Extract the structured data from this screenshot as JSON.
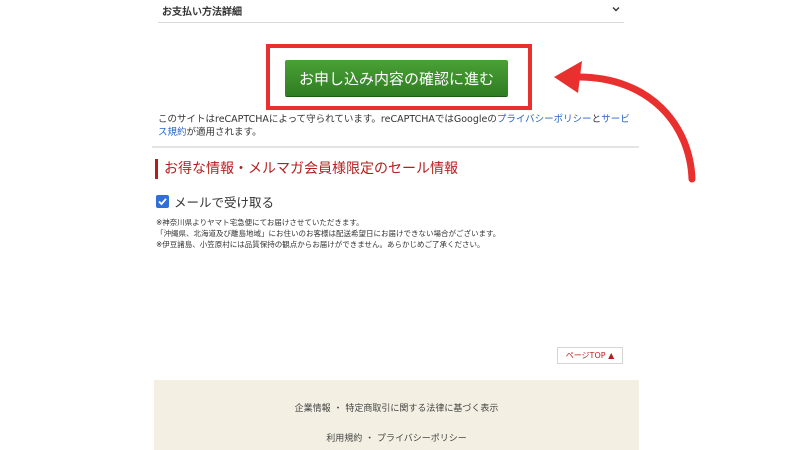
{
  "payment": {
    "label": "お支払い方法詳細"
  },
  "confirm": {
    "button_label": "お申し込み内容の確認に進む"
  },
  "recaptcha": {
    "prefix": "このサイトはreCAPTCHAによって守られています。reCAPTCHAではGoogleの",
    "privacy_link": "プライバシーポリシー",
    "conjunction": "と",
    "terms_link": "サービス規約",
    "suffix": "が適用されます。"
  },
  "newsletter": {
    "title": "お得な情報・メルマガ会員様限定のセール情報",
    "checkbox_label": "メールで受け取る",
    "checked": true,
    "notes": [
      "※神奈川県よりヤマト宅急便にてお届けさせていただきます。",
      "「沖縄県、北海道及び離島地域」にお住いのお客様は配送希望日にお届けできない場合がございます。",
      "※伊豆諸島、小笠原村には品質保持の観点からお届けができません。あらかじめご了承ください。"
    ]
  },
  "pagetop": {
    "label": "ページTOP ▲"
  },
  "footer": {
    "line1": "企業情報 ・ 特定商取引に関する法律に基づく表示",
    "line2": "利用規約 ・ プライバシーポリシー"
  },
  "colors": {
    "highlight": "#e8302e",
    "button_green": "#3a8f2b",
    "section_red": "#b51e1e",
    "link_blue": "#2a64c5",
    "footer_bg": "#f3efe2"
  }
}
